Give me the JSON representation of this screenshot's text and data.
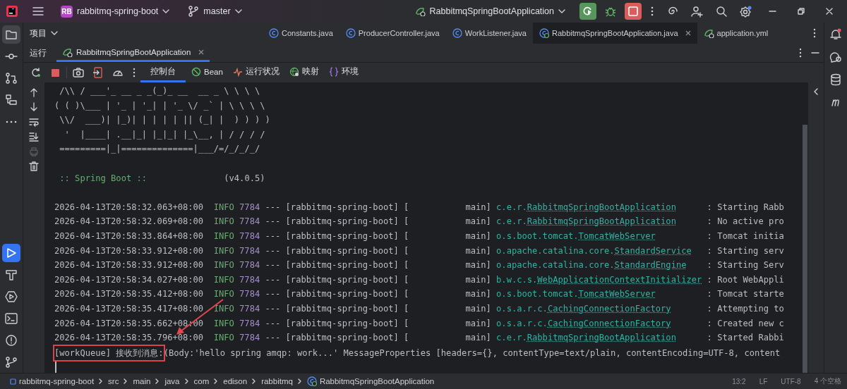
{
  "title_bar": {
    "project_badge": "RB",
    "project": "rabbitmq-spring-boot",
    "branch": "master",
    "run_config": "RabbitmqSpringBootApplication"
  },
  "left_tools": [
    {
      "kind": "project",
      "selected": true
    },
    {
      "kind": "commit",
      "selected": false
    },
    {
      "kind": "pull",
      "selected": false
    },
    {
      "kind": "structure",
      "selected": false
    },
    {
      "kind": "more",
      "selected": false
    },
    {
      "kind": "run",
      "selected": true
    },
    {
      "kind": "build",
      "selected": false
    },
    {
      "kind": "services",
      "selected": false
    },
    {
      "kind": "terminal",
      "selected": false
    },
    {
      "kind": "problems",
      "selected": false
    },
    {
      "kind": "git",
      "selected": false
    }
  ],
  "project_header": {
    "label": "项目"
  },
  "editor_tabs": [
    {
      "label": "Constants.java",
      "kind": "class",
      "selected": false
    },
    {
      "label": "ProducerController.java",
      "kind": "class",
      "selected": false
    },
    {
      "label": "WorkListener.java",
      "kind": "class",
      "selected": false
    },
    {
      "label": "RabbitmqSpringBootApplication.java",
      "kind": "app",
      "selected": true
    },
    {
      "label": "application.yml",
      "kind": "yml",
      "selected": false
    }
  ],
  "run_panel": {
    "label": "运行",
    "tabs": [
      {
        "label": "RabbitmqSpringBootApplication",
        "selected": true
      }
    ]
  },
  "console_tabs": [
    {
      "label": "控制台",
      "kind": "console",
      "selected": true
    },
    {
      "label": "Bean",
      "kind": "bean",
      "selected": false
    },
    {
      "label": "运行状况",
      "kind": "health",
      "selected": false
    },
    {
      "label": "映射",
      "kind": "mappings",
      "selected": false
    },
    {
      "label": "环境",
      "kind": "env",
      "selected": false
    }
  ],
  "gutter_tools": [
    {
      "kind": "up",
      "disabled": false
    },
    {
      "kind": "down",
      "disabled": false
    },
    {
      "kind": "wrap",
      "disabled": false
    },
    {
      "kind": "scroll-end",
      "disabled": false
    },
    {
      "kind": "print",
      "disabled": true
    },
    {
      "kind": "clear",
      "disabled": false
    }
  ],
  "banner": [
    " /\\\\ / ___'_ __ _ _(_)_ __  __ _ \\ \\ \\ \\",
    "( ( )\\___ | '_ | '_| | '_ \\/ _` | \\ \\ \\ \\",
    " \\\\/  ___)| |_)| | | | | || (_| |  ) ) ) )",
    "  '  |____| .__|_| |_|_| |_\\__, | / / / /",
    " =========|_|==============|___/=/_/_/_/"
  ],
  "spring_boot": {
    "label": " :: Spring Boot ::",
    "version": "(v4.0.5)"
  },
  "log_lines": [
    {
      "timestamp": "2026-04-13T20:58:32.063+08:00",
      "level": "INFO",
      "pid": "7784",
      "separator": "---",
      "app": "[rabbitmq-spring-boot]",
      "thread": "[           main]",
      "logger_package": "c.e.r.",
      "logger_class": "RabbitmqSpringBootApplication",
      "message": ": Starting Rabb"
    },
    {
      "timestamp": "2026-04-13T20:58:32.069+08:00",
      "level": "INFO",
      "pid": "7784",
      "separator": "---",
      "app": "[rabbitmq-spring-boot]",
      "thread": "[           main]",
      "logger_package": "c.e.r.",
      "logger_class": "RabbitmqSpringBootApplication",
      "message": ": No active pro"
    },
    {
      "timestamp": "2026-04-13T20:58:33.864+08:00",
      "level": "INFO",
      "pid": "7784",
      "separator": "---",
      "app": "[rabbitmq-spring-boot]",
      "thread": "[           main]",
      "logger_package": "o.s.boot.tomcat.",
      "logger_class": "TomcatWebServer",
      "message": ": Tomcat initia"
    },
    {
      "timestamp": "2026-04-13T20:58:33.912+08:00",
      "level": "INFO",
      "pid": "7784",
      "separator": "---",
      "app": "[rabbitmq-spring-boot]",
      "thread": "[           main]",
      "logger_package": "o.apache.catalina.core.",
      "logger_class": "StandardService",
      "message": ": Starting serv"
    },
    {
      "timestamp": "2026-04-13T20:58:33.912+08:00",
      "level": "INFO",
      "pid": "7784",
      "separator": "---",
      "app": "[rabbitmq-spring-boot]",
      "thread": "[           main]",
      "logger_package": "o.apache.catalina.core.",
      "logger_class": "StandardEngine",
      "message": ": Starting Serv"
    },
    {
      "timestamp": "2026-04-13T20:58:34.027+08:00",
      "level": "INFO",
      "pid": "7784",
      "separator": "---",
      "app": "[rabbitmq-spring-boot]",
      "thread": "[           main]",
      "logger_package": "b.w.c.s.",
      "logger_class": "WebApplicationContextInitializer",
      "message": ": Root WebAppli"
    },
    {
      "timestamp": "2026-04-13T20:58:35.412+08:00",
      "level": "INFO",
      "pid": "7784",
      "separator": "---",
      "app": "[rabbitmq-spring-boot]",
      "thread": "[           main]",
      "logger_package": "o.s.boot.tomcat.",
      "logger_class": "TomcatWebServer",
      "message": ": Tomcat starte"
    },
    {
      "timestamp": "2026-04-13T20:58:35.417+08:00",
      "level": "INFO",
      "pid": "7784",
      "separator": "---",
      "app": "[rabbitmq-spring-boot]",
      "thread": "[           main]",
      "logger_package": "o.s.a.r.c.",
      "logger_class": "CachingConnectionFactory",
      "message": ": Attempting to"
    },
    {
      "timestamp": "2026-04-13T20:58:35.662+08:00",
      "level": "INFO",
      "pid": "7784",
      "separator": "---",
      "app": "[rabbitmq-spring-boot]",
      "thread": "[           main]",
      "logger_package": "o.s.a.r.c.",
      "logger_class": "CachingConnectionFactory",
      "message": ": Created new c"
    },
    {
      "timestamp": "2026-04-13T20:58:35.796+08:00",
      "level": "INFO",
      "pid": "7784",
      "separator": "---",
      "app": "[rabbitmq-spring-boot]",
      "thread": "[           main]",
      "logger_package": "c.e.r.",
      "logger_class": "RabbitmqSpringBootApplication",
      "message": ": Started Rabbi"
    }
  ],
  "message_line": {
    "highlighted": "[workQueue] 接收到消息:",
    "rest": "(Body:'hello spring amqp: work...' MessageProperties [headers={}, contentType=text/plain, contentEncoding=UTF-8, content"
  },
  "breadcrumbs": [
    {
      "label": "rabbitmq-spring-boot",
      "kind": "module"
    },
    {
      "label": "src",
      "kind": "folder"
    },
    {
      "label": "main",
      "kind": "folder"
    },
    {
      "label": "java",
      "kind": "folder"
    },
    {
      "label": "com",
      "kind": "folder"
    },
    {
      "label": "edison",
      "kind": "folder"
    },
    {
      "label": "rabbitmq",
      "kind": "folder"
    },
    {
      "label": "RabbitmqSpringBootApplication",
      "kind": "app"
    }
  ],
  "status": [
    "13:2",
    "LF",
    "UTF-8",
    "4 个空格"
  ]
}
